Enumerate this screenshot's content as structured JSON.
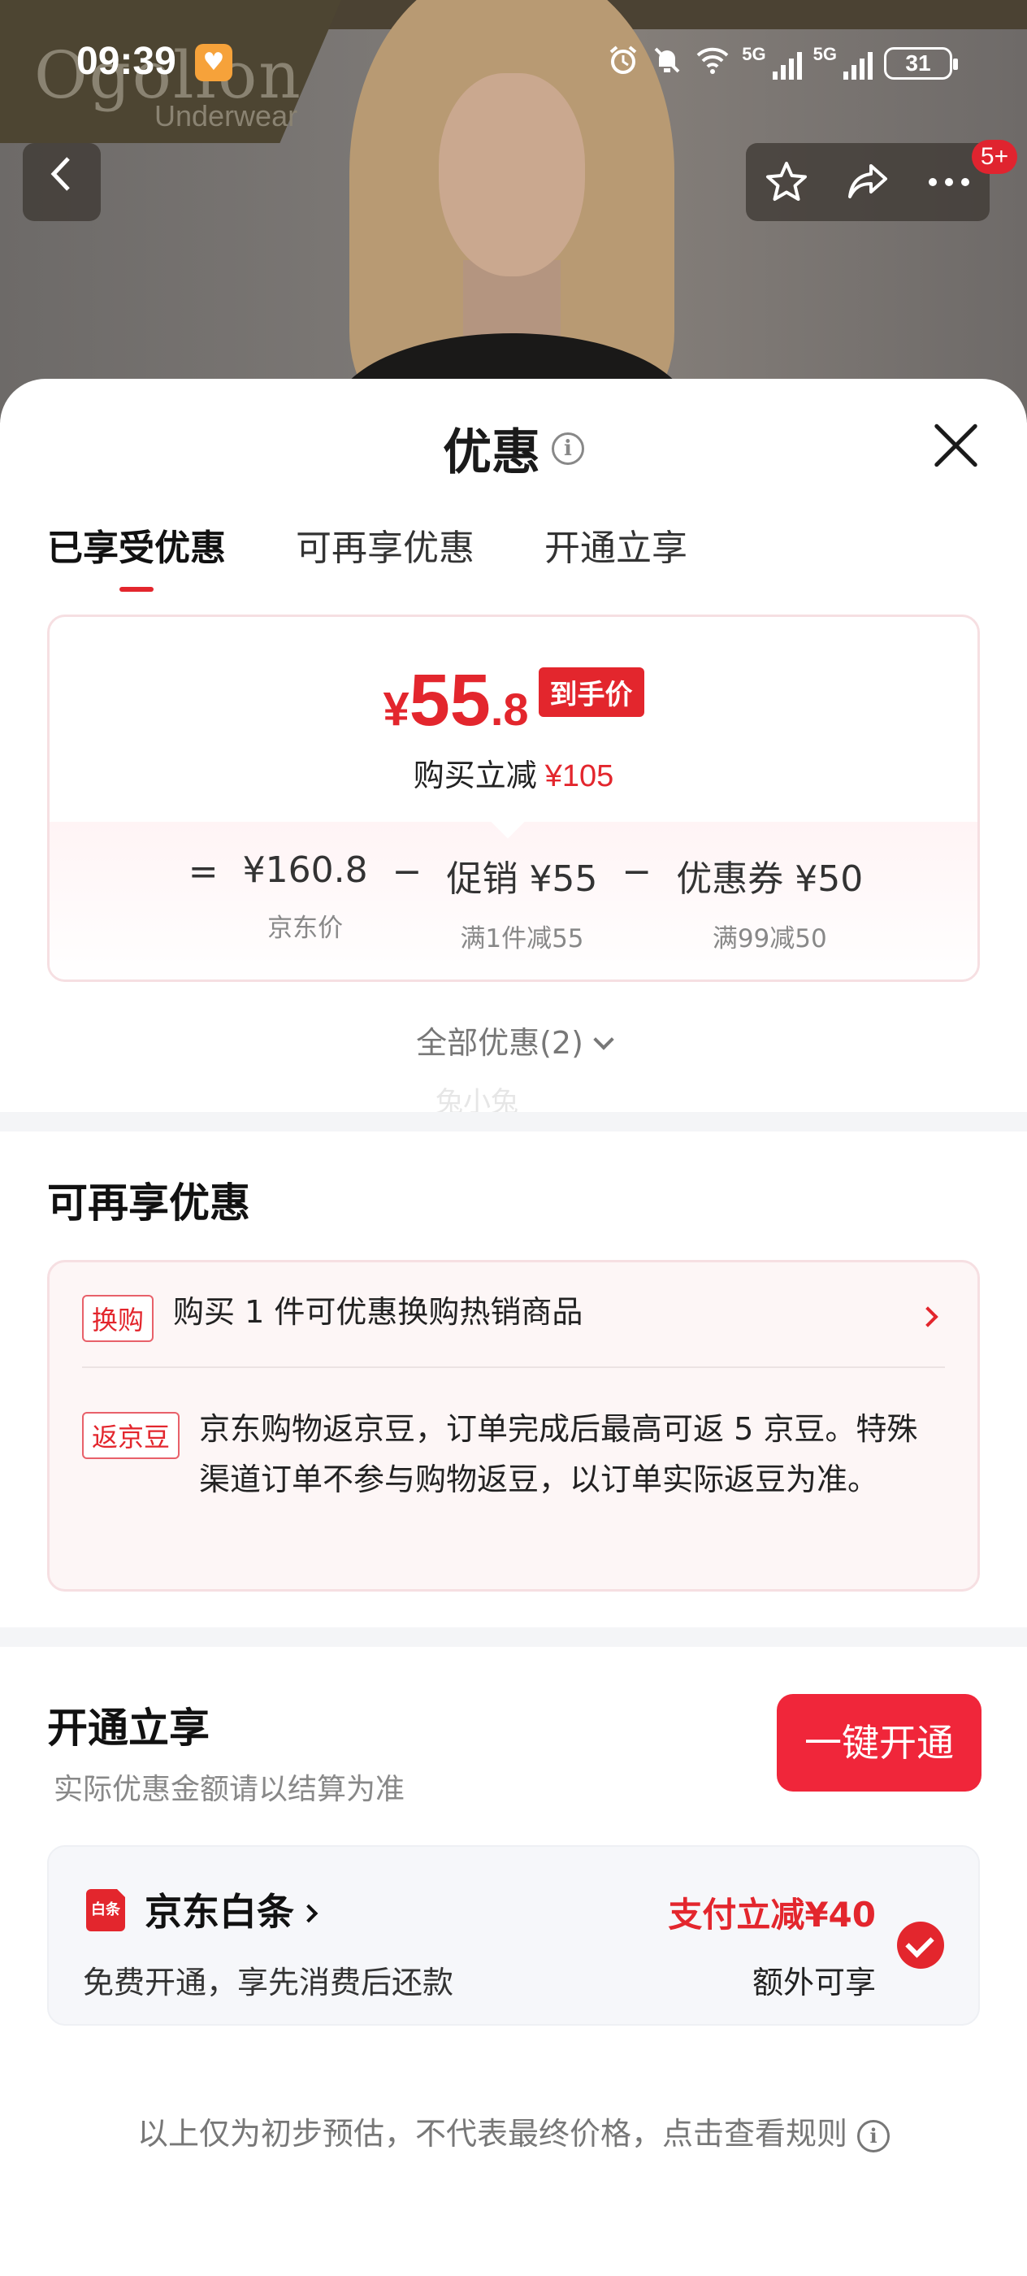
{
  "status_bar": {
    "time": "09:39",
    "network_1": "5G",
    "network_2": "5G",
    "battery": "31"
  },
  "product_image": {
    "brand_logo": "Ogollon",
    "brand_sub": "Underwear"
  },
  "nav": {
    "badge": "5+"
  },
  "sheet": {
    "title": "优惠",
    "tabs": [
      {
        "label": "已享受优惠",
        "active": true
      },
      {
        "label": "可再享优惠",
        "active": false
      },
      {
        "label": "开通立享",
        "active": false
      }
    ]
  },
  "price_card": {
    "currency": "¥",
    "price_int": "55",
    "price_dec": ".8",
    "final_tag": "到手价",
    "instant_label": "购买立减",
    "instant_amount": "¥105",
    "breakdown": [
      {
        "op": "=",
        "main": "¥160.8",
        "sub": "京东价"
      },
      {
        "op": "−",
        "main": "促销 ¥55",
        "sub": "满1件减55"
      },
      {
        "op": "−",
        "main": "优惠券 ¥50",
        "sub": "满99减50"
      }
    ]
  },
  "all_offers": "全部优惠(2)",
  "watermark": "兔小兔",
  "more_offers": {
    "title": "可再享优惠",
    "items": [
      {
        "tag": "换购",
        "text": "购买 1 件可优惠换购热销商品"
      },
      {
        "tag": "返京豆",
        "text": "京东购物返京豆，订单完成后最高可返 5 京豆。特殊渠道订单不参与购物返豆，以订单实际返豆为准。"
      }
    ]
  },
  "join": {
    "title": "开通立享",
    "subtitle": "实际优惠金额请以结算为准",
    "button": "一键开通",
    "icon_text": "白条",
    "service_name": "京东白条",
    "service_desc": "免费开通，享先消费后还款",
    "reduce": "支付立减¥40",
    "extra": "额外可享"
  },
  "footer_note": "以上仅为初步预估，不代表最终价格，点击查看规则",
  "colors": {
    "accent": "#e3262d",
    "button": "#f0263a",
    "card_border": "#f6dfe2"
  }
}
